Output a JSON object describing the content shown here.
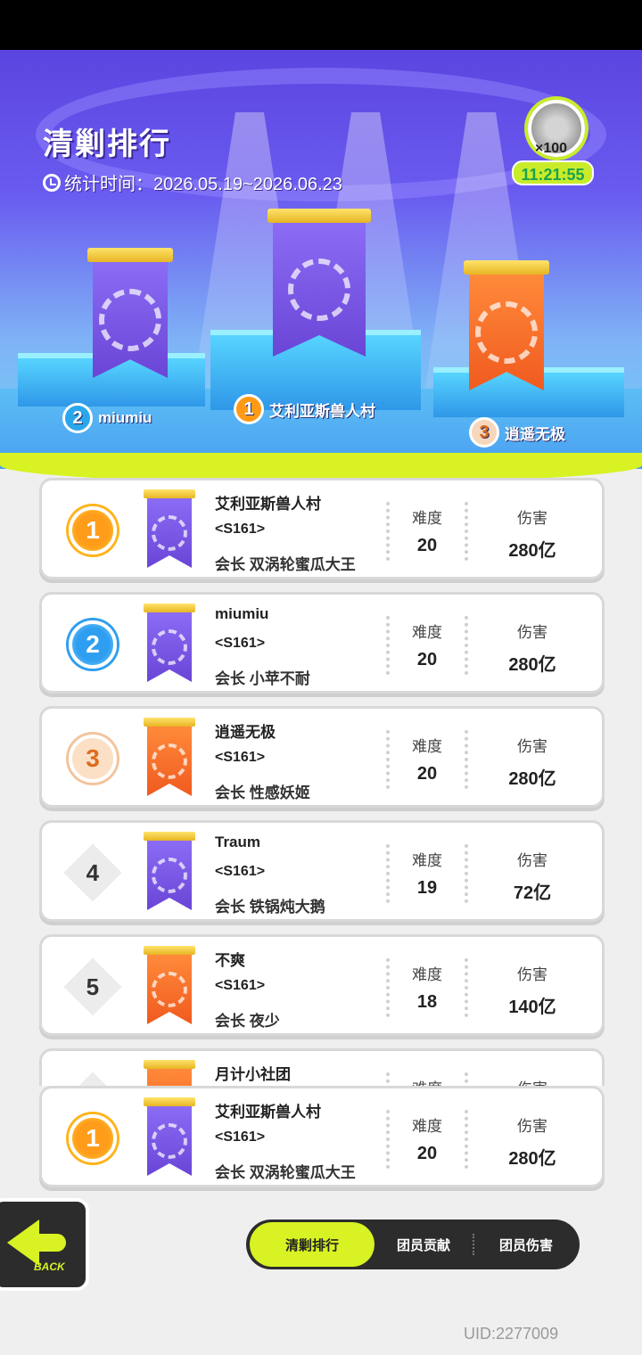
{
  "page": {
    "title": "清剿排行",
    "period_label": "统计时间：2026.05.19~2026.06.23",
    "uid": "UID:2277009"
  },
  "reward": {
    "count": "×100",
    "timer": "11:21:55"
  },
  "podium": [
    {
      "rank": "1",
      "name": "艾利亚斯兽人村",
      "color": "purple"
    },
    {
      "rank": "2",
      "name": "miumiu",
      "color": "purple"
    },
    {
      "rank": "3",
      "name": "逍遥无极",
      "color": "orange"
    }
  ],
  "columns": {
    "difficulty": "难度",
    "damage": "伤害"
  },
  "ranking": [
    {
      "rank": "1",
      "name": "艾利亚斯兽人村",
      "server": "<S161>",
      "leader": "会长  双涡轮蜜瓜大王",
      "difficulty": "20",
      "damage": "280亿",
      "color": "purple"
    },
    {
      "rank": "2",
      "name": "miumiu",
      "server": "<S161>",
      "leader": "会长  小苹不耐",
      "difficulty": "20",
      "damage": "280亿",
      "color": "purple"
    },
    {
      "rank": "3",
      "name": "逍遥无极",
      "server": "<S161>",
      "leader": "会长  性感妖姬",
      "difficulty": "20",
      "damage": "280亿",
      "color": "orange"
    },
    {
      "rank": "4",
      "name": "Traum",
      "server": "<S161>",
      "leader": "会长  铁锅炖大鹅",
      "difficulty": "19",
      "damage": "72亿",
      "color": "purple"
    },
    {
      "rank": "5",
      "name": "不爽",
      "server": "<S161>",
      "leader": "会长  夜少",
      "difficulty": "18",
      "damage": "140亿",
      "color": "orange"
    },
    {
      "rank": "",
      "name": "月计小社团",
      "server": "",
      "leader": "",
      "difficulty": "",
      "damage": "",
      "color": "orange"
    }
  ],
  "my_rank": {
    "rank": "1",
    "name": "艾利亚斯兽人村",
    "server": "<S161>",
    "leader": "会长  双涡轮蜜瓜大王",
    "difficulty": "20",
    "damage": "280亿"
  },
  "nav": {
    "back_label": "BACK",
    "tabs": [
      "清剿排行",
      "团员贡献",
      "团员伤害"
    ]
  },
  "colors": {
    "accent": "#d8f223",
    "gold": "#ff9a16",
    "blue": "#2aa7ec",
    "purple_banner": "#7a58e6",
    "orange_banner": "#f26b27"
  }
}
